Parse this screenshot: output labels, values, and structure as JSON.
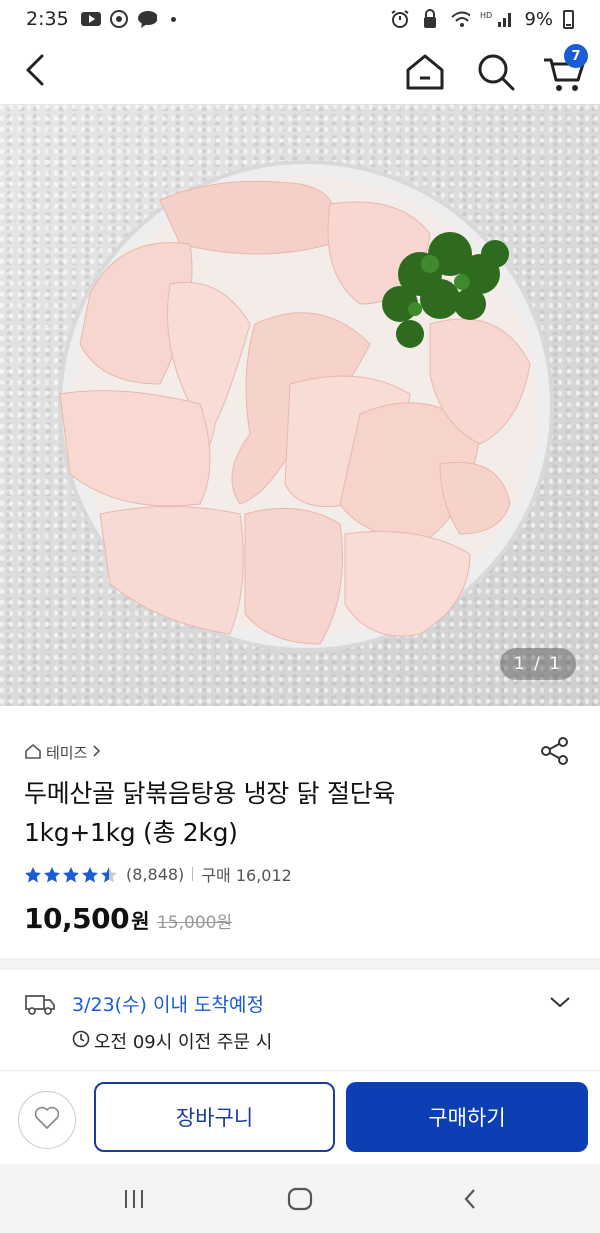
{
  "status_bar": {
    "time": "2:35",
    "battery": "9%",
    "icons": [
      "youtube-icon",
      "podcast-icon",
      "chat-icon",
      "alarm-icon",
      "vpn-icon",
      "wifi-icon",
      "signal-icon",
      "battery-icon"
    ]
  },
  "header": {
    "cart_count": "7",
    "icons": [
      "back-arrow-icon",
      "home-icon",
      "search-icon",
      "cart-icon"
    ]
  },
  "hero": {
    "pager": "1 / 1"
  },
  "product": {
    "breadcrumb": "테미즈",
    "title_line1": "두메산골 닭볶음탕용 냉장 닭 절단육",
    "title_line2": "1kg+1kg (총 2kg)",
    "rating": 4.5,
    "review_count": "(8,848)",
    "purchase_label": "구매 16,012",
    "price": "10,500",
    "currency": "원",
    "original_price": "15,000원"
  },
  "delivery": {
    "date_text": "3/23(수) 이내 도착예정",
    "cutoff_text": "오전 09시 이전 주문 시"
  },
  "actions": {
    "add_to_cart": "장바구니",
    "buy_now": "구매하기"
  },
  "colors": {
    "accent": "#1a5cd6",
    "buy_button": "#0c3fb3",
    "cart_border": "#1a3c9c",
    "star": "#1a5cd6"
  }
}
